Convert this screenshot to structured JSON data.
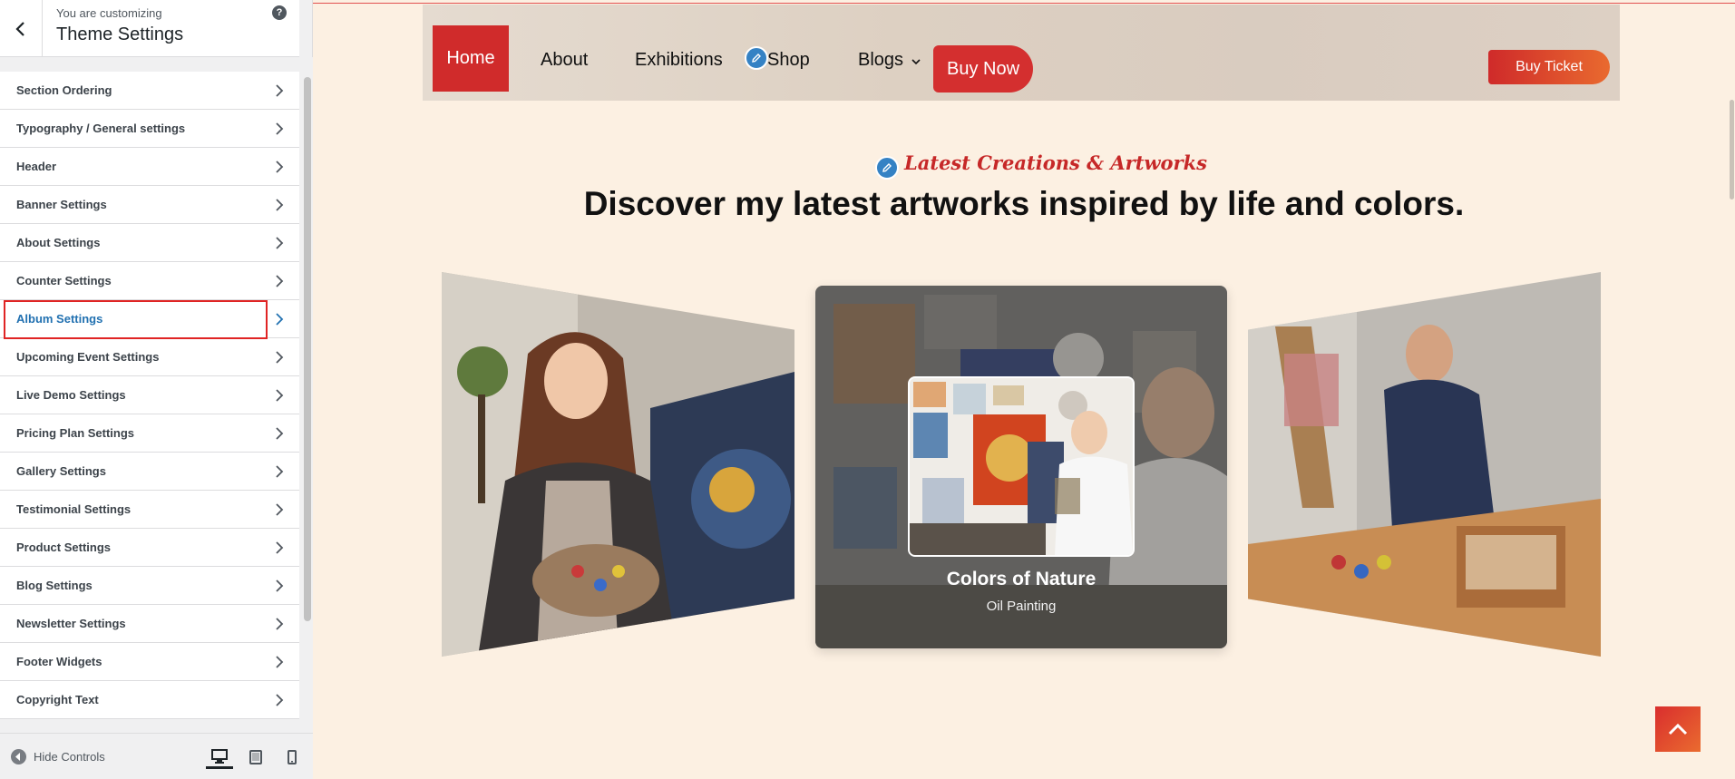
{
  "customizer": {
    "subtitle": "You are customizing",
    "title": "Theme Settings",
    "help_glyph": "?",
    "items": [
      {
        "label": "Section Ordering"
      },
      {
        "label": "Typography / General settings"
      },
      {
        "label": "Header"
      },
      {
        "label": "Banner Settings"
      },
      {
        "label": "About Settings"
      },
      {
        "label": "Counter Settings"
      },
      {
        "label": "Album Settings",
        "active": true
      },
      {
        "label": "Upcoming Event Settings"
      },
      {
        "label": "Live Demo Settings"
      },
      {
        "label": "Pricing Plan Settings"
      },
      {
        "label": "Gallery Settings"
      },
      {
        "label": "Testimonial Settings"
      },
      {
        "label": "Product Settings"
      },
      {
        "label": "Blog Settings"
      },
      {
        "label": "Newsletter Settings"
      },
      {
        "label": "Footer Widgets"
      },
      {
        "label": "Copyright Text"
      }
    ],
    "footer": {
      "hide_controls": "Hide Controls",
      "devices": [
        "desktop-icon",
        "tablet-icon",
        "mobile-icon"
      ],
      "active_device": "desktop"
    }
  },
  "preview": {
    "nav": {
      "home": "Home",
      "about": "About",
      "exhibitions": "Exhibitions",
      "shop": "Shop",
      "blogs": "Blogs",
      "buy_now": "Buy Now",
      "buy_ticket": "Buy Ticket"
    },
    "section": {
      "eyebrow": "Latest Creations & Artworks",
      "heading": "Discover my latest artworks inspired by life and colors."
    },
    "center_card": {
      "title": "Colors of Nature",
      "subtitle": "Oil Painting"
    }
  },
  "colors": {
    "accent_red": "#d02b2b",
    "accent_orange": "#e96a2f",
    "wp_blue": "#2271b1",
    "page_bg": "#fcf0e2"
  }
}
